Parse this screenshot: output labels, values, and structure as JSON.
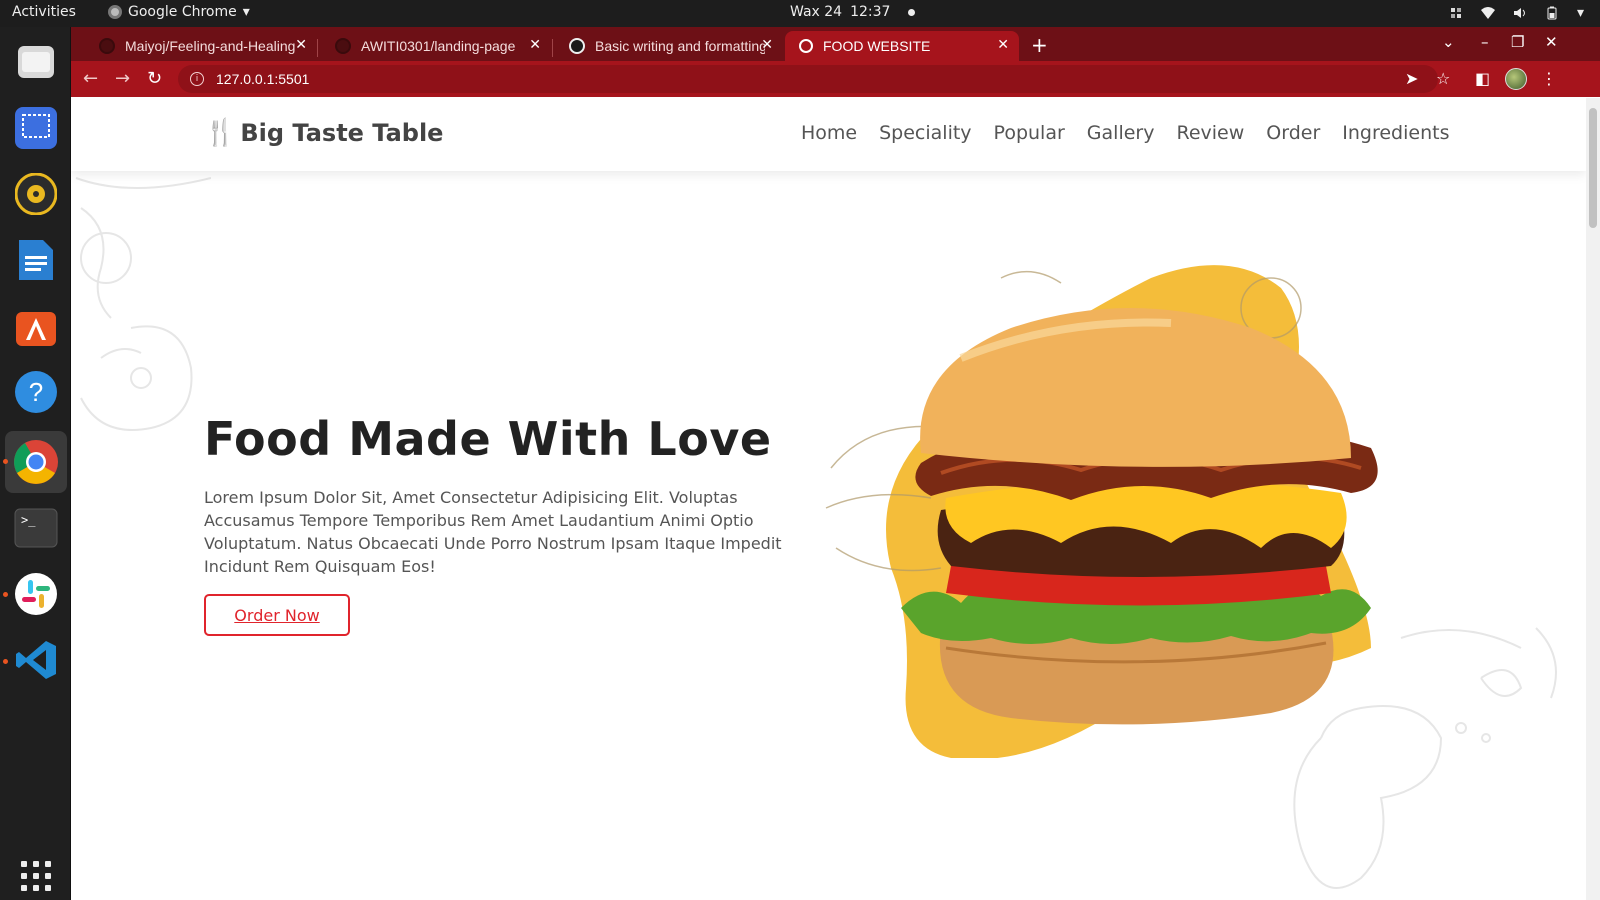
{
  "system": {
    "activities": "Activities",
    "app_name": "Google Chrome",
    "clock_day": "Wax 24",
    "clock_time": "12:37"
  },
  "browser": {
    "tabs": [
      {
        "title": "Maiyoj/Feeling-and-Healing",
        "icon": "github-icon"
      },
      {
        "title": "AWITI0301/landing-page",
        "icon": "github-icon"
      },
      {
        "title": "Basic writing and formatting",
        "icon": "github-icon"
      },
      {
        "title": "FOOD WEBSITE",
        "icon": "globe-icon"
      }
    ],
    "url": "127.0.0.1:5501",
    "theme_color": "#a6141c"
  },
  "site": {
    "brand": "Big Taste Table",
    "nav": [
      "Home",
      "Speciality",
      "Popular",
      "Gallery",
      "Review",
      "Order",
      "Ingredients"
    ],
    "hero": {
      "title": "Food Made With Love",
      "text": "Lorem Ipsum Dolor Sit, Amet Consectetur Adipisicing Elit. Voluptas Accusamus Tempore Temporibus Rem Amet Laudantium Animi Optio Voluptatum. Natus Obcaecati Unde Porro Nostrum Ipsam Itaque Impedit Incidunt Rem Quisquam Eos!",
      "button": "Order Now"
    },
    "accent_color": "#e0242c",
    "blob_color": "#f4bd3a"
  }
}
